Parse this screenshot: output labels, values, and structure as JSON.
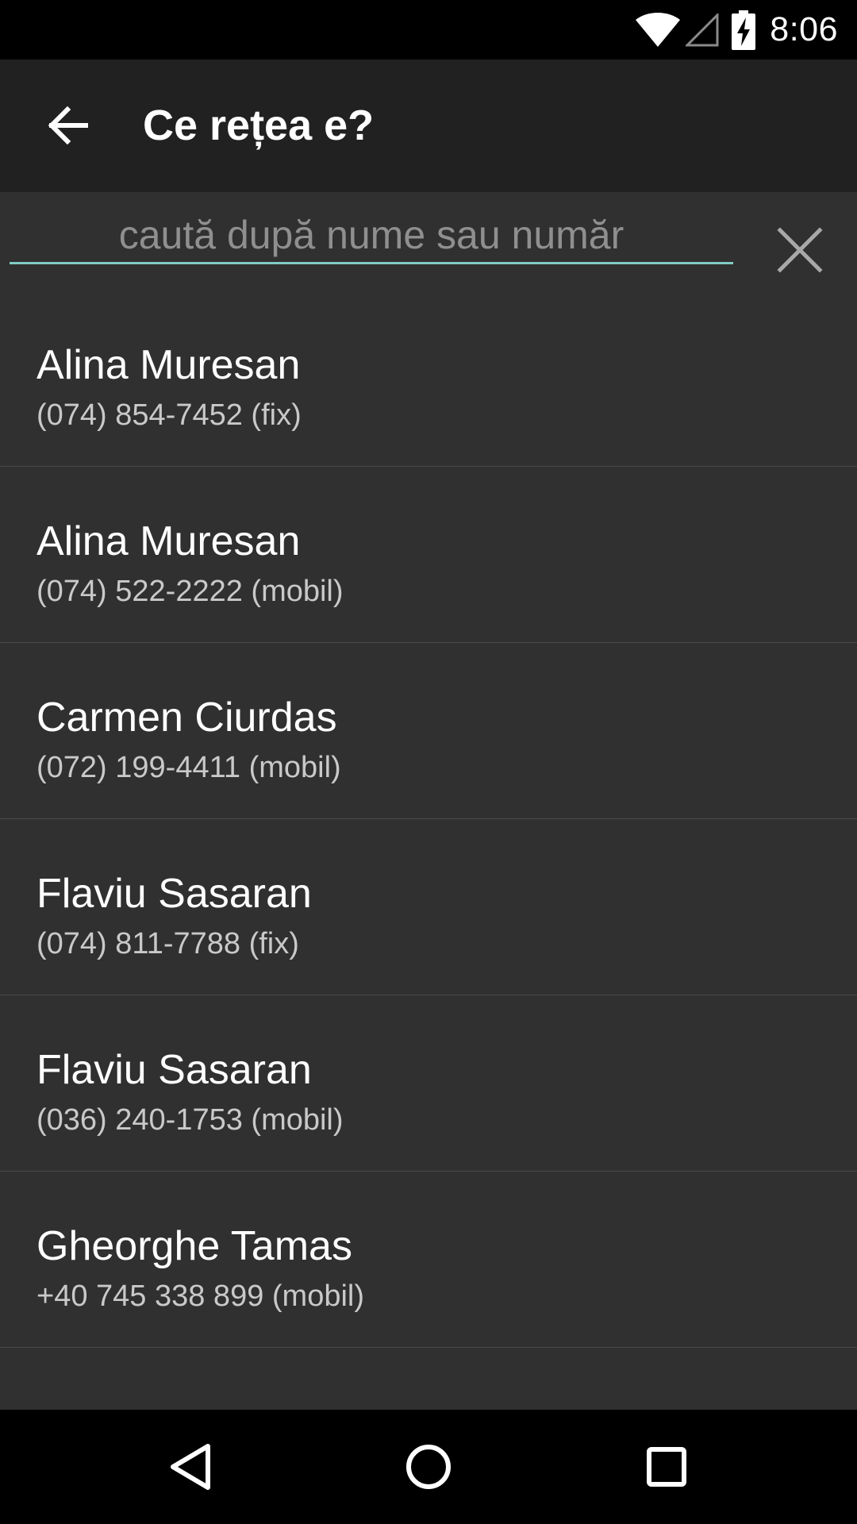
{
  "status_bar": {
    "time": "8:06",
    "icons": [
      "wifi-icon",
      "cell-signal-icon",
      "battery-charging-icon"
    ]
  },
  "app_bar": {
    "back_icon": "arrow-left-icon",
    "title": "Ce rețea e?"
  },
  "search": {
    "value": "",
    "placeholder": "caută după nume sau număr",
    "clear_icon": "close-icon",
    "underline_color": "#80cbc4"
  },
  "contacts": [
    {
      "name": "Alina Muresan",
      "number": "(074) 854-7452 (fix)"
    },
    {
      "name": "Alina Muresan",
      "number": "(074) 522-2222 (mobil)"
    },
    {
      "name": "Carmen Ciurdas",
      "number": "(072) 199-4411 (mobil)"
    },
    {
      "name": "Flaviu Sasaran",
      "number": "(074) 811-7788 (fix)"
    },
    {
      "name": "Flaviu Sasaran",
      "number": "(036) 240-1753 (mobil)"
    },
    {
      "name": "Gheorghe Tamas",
      "number": "+40 745 338 899 (mobil)"
    }
  ],
  "nav_bar": {
    "icons": [
      "nav-back-icon",
      "nav-home-icon",
      "nav-recents-icon"
    ]
  },
  "colors": {
    "status_bar": "#000000",
    "app_bar": "#212121",
    "background": "#303030",
    "divider": "#4a4a4a",
    "secondary_text": "#c9c9c9"
  }
}
